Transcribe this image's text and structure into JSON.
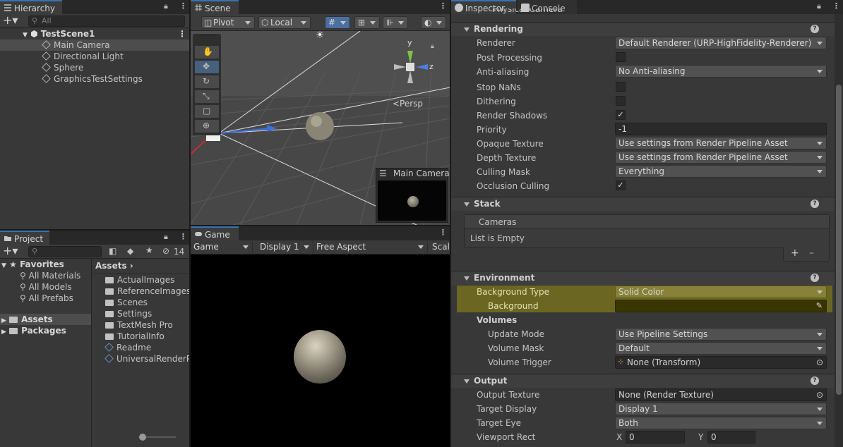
{
  "hierarchy": {
    "tab": "Hierarchy",
    "search_placeholder": "All",
    "items": [
      {
        "label": "TestScene1"
      },
      {
        "label": "Main Camera"
      },
      {
        "label": "Directional Light"
      },
      {
        "label": "Sphere"
      },
      {
        "label": "GraphicsTestSettings"
      }
    ]
  },
  "project": {
    "tab": "Project",
    "hidden_count": "14",
    "favorites": {
      "label": "Favorites",
      "items": [
        "All Materials",
        "All Models",
        "All Prefabs"
      ]
    },
    "tree": [
      "Assets",
      "Packages"
    ],
    "breadcrumb": "Assets",
    "assets": [
      {
        "label": "ActualImages",
        "type": "folder"
      },
      {
        "label": "ReferenceImages",
        "type": "folder"
      },
      {
        "label": "Scenes",
        "type": "folder"
      },
      {
        "label": "Settings",
        "type": "folder"
      },
      {
        "label": "TextMesh Pro",
        "type": "folder"
      },
      {
        "label": "TutorialInfo",
        "type": "folder"
      },
      {
        "label": "Readme",
        "type": "asset"
      },
      {
        "label": "UniversalRenderP",
        "type": "asset"
      }
    ]
  },
  "scene": {
    "tab": "Scene",
    "pivot": "Pivot",
    "local": "Local",
    "persp": "<Persp",
    "gizmo": {
      "y": "y",
      "z": "z"
    },
    "preview_title": "Main Camera"
  },
  "game": {
    "tab": "Game",
    "display_mode": "Game",
    "display": "Display 1",
    "aspect": "Free Aspect",
    "scale": "Scal"
  },
  "inspector": {
    "tab": "Inspector",
    "console_tab": "Console",
    "top_partial": "Physical Camera",
    "rendering": {
      "title": "Rendering",
      "rows": [
        {
          "label": "Renderer",
          "kind": "dropdown",
          "value": "Default Renderer (URP-HighFidelity-Renderer)"
        },
        {
          "label": "Post Processing",
          "kind": "checkbox",
          "value": ""
        },
        {
          "label": "Anti-aliasing",
          "kind": "dropdown",
          "value": "No Anti-aliasing"
        },
        {
          "label": "Stop NaNs",
          "kind": "checkbox",
          "value": ""
        },
        {
          "label": "Dithering",
          "kind": "checkbox",
          "value": ""
        },
        {
          "label": "Render Shadows",
          "kind": "checkbox",
          "value": "✓"
        },
        {
          "label": "Priority",
          "kind": "field",
          "value": "-1"
        },
        {
          "label": "Opaque Texture",
          "kind": "dropdown",
          "value": "Use settings from Render Pipeline Asset"
        },
        {
          "label": "Depth Texture",
          "kind": "dropdown",
          "value": "Use settings from Render Pipeline Asset"
        },
        {
          "label": "Culling Mask",
          "kind": "dropdown",
          "value": "Everything"
        },
        {
          "label": "Occlusion Culling",
          "kind": "checkbox",
          "value": "✓"
        }
      ]
    },
    "stack": {
      "title": "Stack",
      "list_header": "Cameras",
      "empty": "List is Empty",
      "add": "+",
      "remove": "–"
    },
    "environment": {
      "title": "Environment",
      "background_type_label": "Background Type",
      "background_type": "Solid Color",
      "background_label": "Background",
      "background_color": "#3a3600",
      "volumes_label": "Volumes",
      "update_mode_label": "Update Mode",
      "update_mode": "Use Pipeline Settings",
      "volume_mask_label": "Volume Mask",
      "volume_mask": "Default",
      "volume_trigger_label": "Volume Trigger",
      "volume_trigger": "None (Transform)"
    },
    "output": {
      "title": "Output",
      "output_texture_label": "Output Texture",
      "output_texture": "None (Render Texture)",
      "target_display_label": "Target Display",
      "target_display": "Display 1",
      "target_eye_label": "Target Eye",
      "target_eye": "Both",
      "viewport_rect_label": "Viewport Rect",
      "x_label": "X",
      "x_value": "0",
      "y_label": "Y",
      "y_value": "0"
    }
  },
  "colors": {
    "accent": "#3a72b0",
    "highlight": "#6b6722",
    "panel": "#383838"
  }
}
